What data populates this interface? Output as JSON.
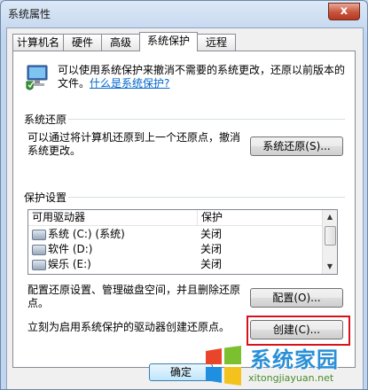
{
  "window": {
    "title": "系统属性",
    "close_glyph": "x"
  },
  "tabs": [
    {
      "label": "计算机名"
    },
    {
      "label": "硬件"
    },
    {
      "label": "高级"
    },
    {
      "label": "系统保护"
    },
    {
      "label": "远程"
    }
  ],
  "intro": {
    "text": "可以使用系统保护来撤消不需要的系统更改，还原以前版本的文件。",
    "link": "什么是系统保护?"
  },
  "restore": {
    "heading": "系统还原",
    "description": "可以通过将计算机还原到上一个还原点，撤消系统更改。",
    "button": "系统还原(S)..."
  },
  "protection": {
    "heading": "保护设置",
    "columns": [
      "可用驱动器",
      "保护"
    ],
    "rows": [
      {
        "drive": "系统 (C:) (系统)",
        "status": "关闭"
      },
      {
        "drive": "软件 (D:)",
        "status": "关闭"
      },
      {
        "drive": "娱乐 (E:)",
        "status": "关闭"
      }
    ],
    "configure_text": "配置还原设置、管理磁盘空间，并且删除还原点。",
    "configure_button": "配置(O)...",
    "create_text": "立刻为启用系统保护的驱动器创建还原点。",
    "create_button": "创建(C)..."
  },
  "footer": {
    "ok_button": "确定"
  },
  "watermark": {
    "title": "系统家园",
    "url": "xitongjiayuan.net"
  },
  "colors": {
    "highlight": "#d8121a",
    "link": "#0066cc"
  }
}
